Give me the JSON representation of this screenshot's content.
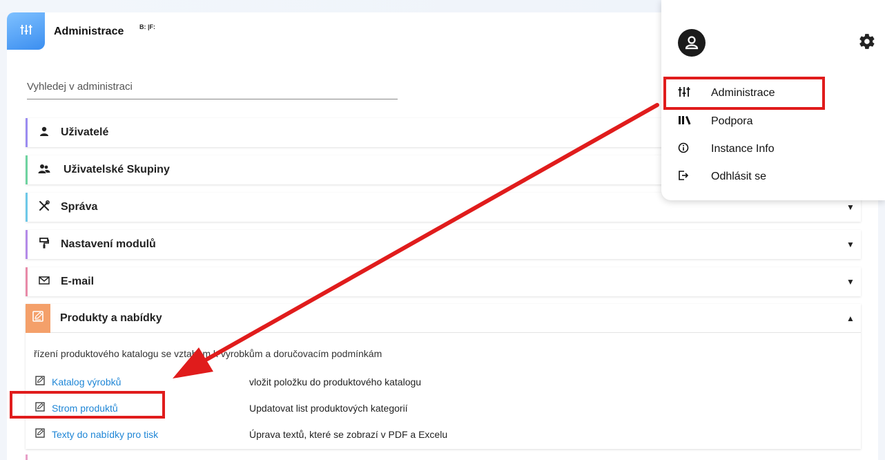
{
  "header": {
    "title": "Administrace",
    "badge": "B: |F:",
    "icon": "sliders-icon",
    "tile_colors": [
      "#7fc1ff",
      "#3b8ef0"
    ]
  },
  "search": {
    "placeholder": "Vyhledej v administraci"
  },
  "sections": [
    {
      "label": "Uživatelé",
      "icon": "user-icon",
      "accent": "#9b8cf0"
    },
    {
      "label": "Uživatelské Skupiny",
      "icon": "user-group-icon",
      "accent": "#6fd3a0"
    },
    {
      "label": "Správa",
      "icon": "tools-icon",
      "accent": "#6ec8e8",
      "caret": "▼"
    },
    {
      "label": "Nastavení modulů",
      "icon": "paint-roller-icon",
      "accent": "#b48ae8",
      "caret": "▼"
    },
    {
      "label": "E-mail",
      "icon": "envelope-icon",
      "accent": "#e88aa8",
      "caret": "▼"
    }
  ],
  "products": {
    "label": "Produkty a nabídky",
    "icon": "edit-square-icon",
    "accent": "#f4a06a",
    "caret": "▲",
    "description": "řízení produktového katalogu se vztahem k vyrobkům a doručovacím podmínkám",
    "items": [
      {
        "link": "Katalog výrobků",
        "desc": "vložit položku do produktového katalogu"
      },
      {
        "link": "Strom produktů",
        "desc": "Updatovat list produktových kategorií"
      },
      {
        "link": "Texty do nabídky pro tisk",
        "desc": "Úprava textů, které se zobrazí v PDF a Excelu"
      }
    ]
  },
  "user_menu": {
    "avatar_icon": "user-avatar-icon",
    "settings_icon": "gear-icon",
    "items": [
      {
        "label": "Administrace",
        "icon": "sliders-icon"
      },
      {
        "label": "Podpora",
        "icon": "books-icon"
      },
      {
        "label": "Instance Info",
        "icon": "info-circle-icon"
      },
      {
        "label": "Odhlásit se",
        "icon": "logout-icon"
      }
    ]
  },
  "annotation_color": "#e01c1c"
}
